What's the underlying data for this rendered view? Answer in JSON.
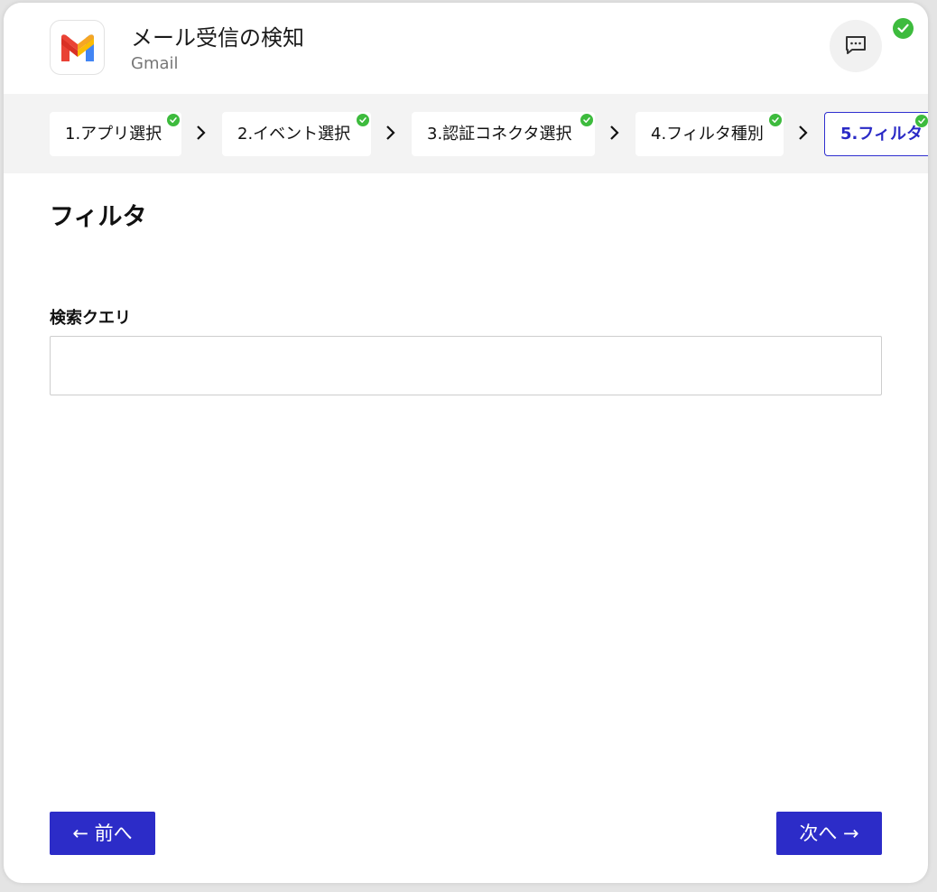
{
  "header": {
    "title": "メール受信の検知",
    "subtitle": "Gmail",
    "logo_icon": "gmail-logo",
    "chat_icon": "chat-bubble-icon",
    "status_icon": "check-circle-icon",
    "status_color": "#3dbb3d"
  },
  "stepper": {
    "steps": [
      {
        "label": "1.アプリ選択",
        "completed": true
      },
      {
        "label": "2.イベント選択",
        "completed": true
      },
      {
        "label": "3.認証コネクタ選択",
        "completed": true
      },
      {
        "label": "4.フィルタ種別",
        "completed": true
      },
      {
        "label": "5.フィルタ",
        "completed": true,
        "active": true
      }
    ],
    "separator_icon": "chevron-right-icon",
    "active_color": "#2a2ac6"
  },
  "main": {
    "section_title": "フィルタ",
    "search_query": {
      "label": "検索クエリ",
      "value": "",
      "placeholder": ""
    }
  },
  "footer": {
    "prev_label": "← 前へ",
    "next_label": "次へ →",
    "button_color": "#2c2cc8"
  }
}
